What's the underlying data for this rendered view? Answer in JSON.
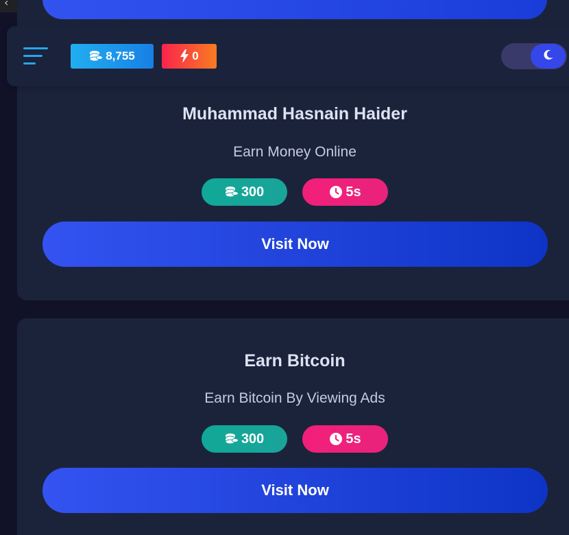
{
  "header": {
    "coin_balance": "8,755",
    "energy_count": "0",
    "menu_icon": "menu-icon",
    "coin_icon": "coins-icon",
    "energy_icon": "lightning-icon",
    "theme_icon": "moon-icon"
  },
  "cards": [
    {
      "title": "Muhammad Hasnain Haider",
      "description": "Earn Money Online",
      "reward": "300",
      "duration": "5s",
      "button_label": "Visit Now"
    },
    {
      "title": "Earn Bitcoin",
      "description": "Earn Bitcoin By Viewing Ads",
      "reward": "300",
      "duration": "5s",
      "button_label": "Visit Now"
    }
  ],
  "colors": {
    "background": "#111228",
    "card": "#1b233b",
    "accent_blue": "#3453f1",
    "coins_badge": "#22aef0",
    "energy_badge": "#f9244c",
    "reward_pill": "#11a897",
    "timer_pill": "#f31f7a"
  }
}
